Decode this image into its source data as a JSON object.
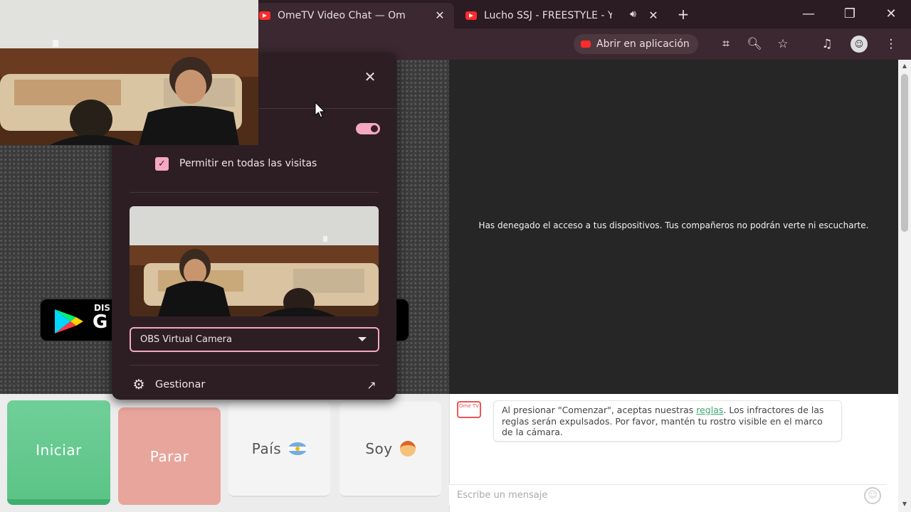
{
  "tabs": [
    {
      "title": "OmeTV Video Chat — Omegle Alternative",
      "active": true
    },
    {
      "title": "Lucho SSJ - FREESTYLE - YouTube",
      "active": false
    }
  ],
  "window_controls": {
    "minimize": "—",
    "restore": "❐",
    "close": "✕"
  },
  "toolbar": {
    "open_in_app": "Abrir en aplicación"
  },
  "page": {
    "denied_message": "Has denegado el acceso a tus dispositivos. Tus compañeros no podrán verte ni escucharte.",
    "gplay_small": "DIS",
    "gplay_big": "G"
  },
  "popup": {
    "allow_all_visits": "Permitir en todas las visitas",
    "camera_device": "OBS Virtual Camera",
    "manage": "Gestionar"
  },
  "buttons": {
    "start": "Iniciar",
    "stop": "Parar",
    "country": "País",
    "gender": "Soy"
  },
  "chat": {
    "logo_text": "Ome TV",
    "rules_before": "Al presionar \"Comenzar\", aceptas nuestras ",
    "rules_link": "reglas",
    "rules_after": ". Los infractores de las reglas serán expulsados. Por favor, mantén tu rostro visible en el marco de la cámara.",
    "input_placeholder": "Escribe un mensaje"
  },
  "colors": {
    "accent_pink": "#f4a8c4",
    "start_green": "#5cc487",
    "stop_salmon": "#e8a59b"
  }
}
